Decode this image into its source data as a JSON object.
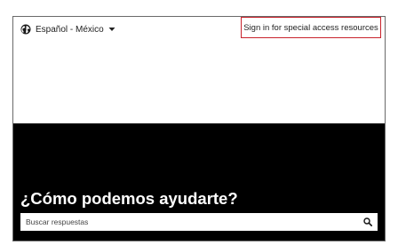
{
  "header": {
    "language_label": "Español - México",
    "language_icon": "globe-icon",
    "dropdown_icon": "caret-down-icon",
    "signin_link": "Sign in for special access resources",
    "highlight_color": "#c8232c"
  },
  "hero": {
    "title": "¿Cómo podemos ayudarte?",
    "background_color": "#000000",
    "search": {
      "placeholder": "Buscar respuestas",
      "value": "",
      "icon": "search-icon"
    }
  }
}
